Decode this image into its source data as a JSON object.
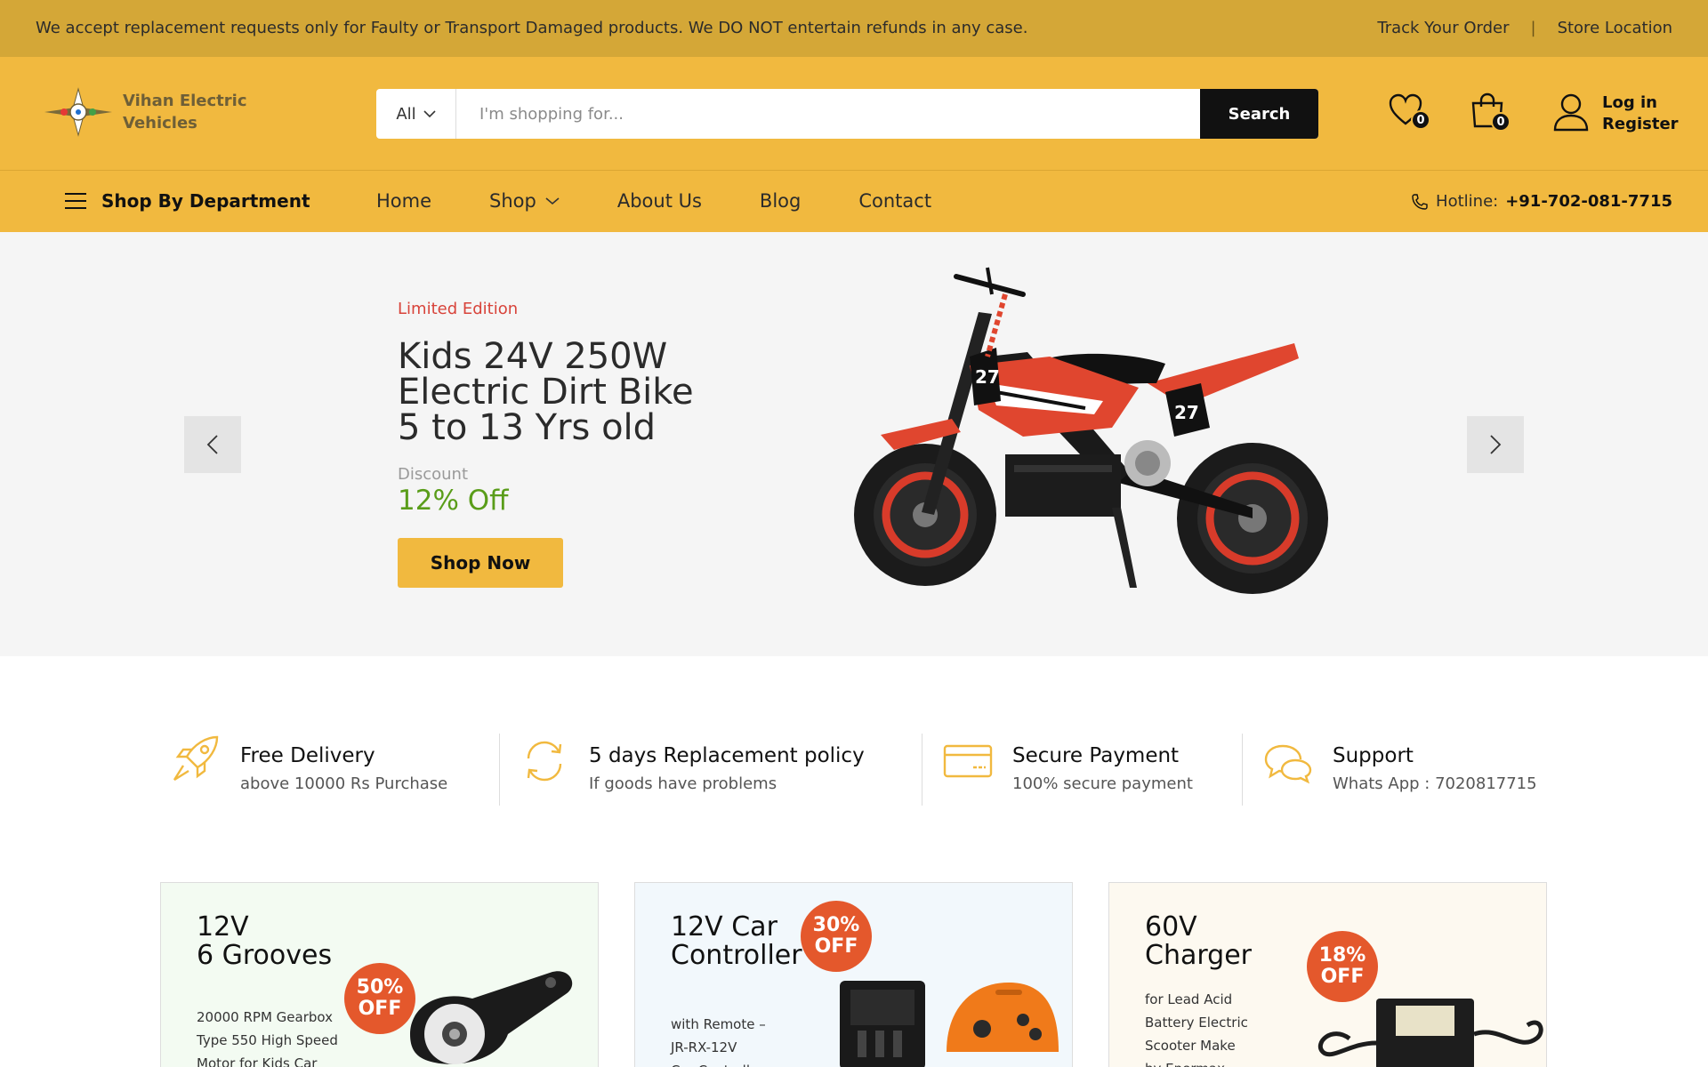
{
  "topbar": {
    "notice": "We accept replacement requests only for Faulty or Transport Damaged products. We DO NOT entertain refunds in any case.",
    "track_order": "Track Your Order",
    "separator": "|",
    "store_location": "Store Location"
  },
  "header": {
    "logo_line1": "Vihan Electric",
    "logo_line2": "Vehicles",
    "search_category": "All",
    "search_placeholder": "I'm shopping for...",
    "search_button": "Search",
    "wishlist_count": "0",
    "cart_count": "0",
    "login": "Log in",
    "register": "Register"
  },
  "nav": {
    "department": "Shop By Department",
    "items": [
      "Home",
      "Shop",
      "About Us",
      "Blog",
      "Contact"
    ],
    "hotline_label": "Hotline:",
    "hotline_number": "+91-702-081-7715"
  },
  "hero": {
    "subtitle": "Limited Edition",
    "title_line1": "Kids 24V 250W",
    "title_line2": "Electric Dirt Bike",
    "title_line3": "5 to 13 Yrs old",
    "discount_label": "Discount",
    "discount_value": "12% Off",
    "button": "Shop Now",
    "bike_numbers": [
      "27",
      "27"
    ]
  },
  "features": [
    {
      "title": "Free Delivery",
      "desc": "above 10000 Rs Purchase",
      "icon": "rocket-icon"
    },
    {
      "title": "5 days Replacement policy",
      "desc": "If goods have problems",
      "icon": "refresh-icon"
    },
    {
      "title": "Secure Payment",
      "desc": "100% secure payment",
      "icon": "credit-card-icon"
    },
    {
      "title": "Support",
      "desc": "Whats App : 7020817715",
      "icon": "chat-icon"
    }
  ],
  "promos": [
    {
      "title1": "12V",
      "title2": "6 Grooves",
      "desc1": "20000 RPM Gearbox",
      "desc2": "Type 550 High Speed",
      "desc3": "Motor for Kids Car",
      "badge1": "50%",
      "badge2": "OFF",
      "bg": "#f3fbf2"
    },
    {
      "title1": "12V Car",
      "title2": "Controller",
      "desc1": "with Remote –",
      "desc2": "JR-RX-12V",
      "desc3": "Car Controller",
      "badge1": "30%",
      "badge2": "OFF",
      "bg": "#f2f8fc"
    },
    {
      "title1": "60V",
      "title2": "Charger",
      "desc1": "for Lead Acid",
      "desc2": "Battery Electric",
      "desc3": "Scooter Make",
      "desc4": "by Enermax",
      "badge1": "18%",
      "badge2": "OFF",
      "bg": "#fdf9f0"
    }
  ],
  "colors": {
    "accent": "#f1b93f",
    "topbar": "#d4a737",
    "sale": "#e4582c",
    "hero_subtitle": "#d8433a",
    "discount": "#5a9d1a"
  }
}
